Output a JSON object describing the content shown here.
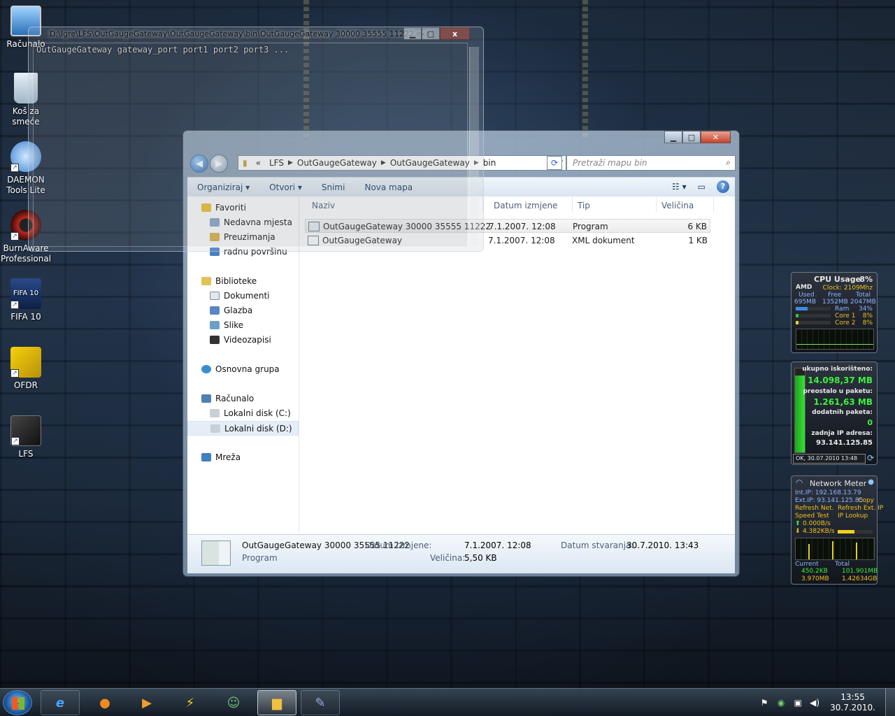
{
  "desktop": {
    "icons": [
      {
        "label": "Računalo",
        "icon": "computer-icon"
      },
      {
        "label": "Koš za smeće",
        "icon": "recycle-bin-icon"
      },
      {
        "label": "DAEMON Tools Lite",
        "icon": "daemon-tools-icon"
      },
      {
        "label": "BurnAware Professional",
        "icon": "burnaware-icon"
      },
      {
        "label": "FIFA 10",
        "icon": "fifa10-icon"
      },
      {
        "label": "OFDR",
        "icon": "ofdr-icon"
      },
      {
        "label": "LFS",
        "icon": "lfs-icon"
      }
    ],
    "icon_badge": "FIFA 10"
  },
  "console": {
    "title": "D:\\Igre\\LFS\\OutGaugeGateway\\OutGaugeGateway\\bin\\OutGaugeGateway 30000 35555 11222.exe",
    "output": "OutGaugeGateway gateway_port port1 port2 port3 ...",
    "close_label": "x"
  },
  "explorer": {
    "breadcrumb": [
      "LFS",
      "OutGaugeGateway",
      "OutGaugeGateway",
      "bin"
    ],
    "breadcrumb_prefix": "«",
    "search_placeholder": "Pretraži mapu bin",
    "toolbar": {
      "organize": "Organiziraj ▾",
      "open": "Otvori ▾",
      "burn": "Snimi",
      "new_folder": "Nova mapa",
      "help": "?"
    },
    "nav": {
      "favorites": "Favoriti",
      "recent": "Nedavna mjesta",
      "downloads": "Preuzimanja",
      "desktop": "radnu površinu",
      "libraries": "Biblioteke",
      "documents": "Dokumenti",
      "music": "Glazba",
      "pictures": "Slike",
      "videos": "Videozapisi",
      "homegroup": "Osnovna grupa",
      "computer": "Računalo",
      "disk_c": "Lokalni disk (C:)",
      "disk_d": "Lokalni disk (D:)",
      "network": "Mreža"
    },
    "columns": [
      "Naziv",
      "Datum izmjene",
      "Tip",
      "Veličina"
    ],
    "files": [
      {
        "name": "OutGaugeGateway 30000 35555 11222",
        "date": "7.1.2007. 12:08",
        "type": "Program",
        "size": "6 KB"
      },
      {
        "name": "OutGaugeGateway",
        "date": "7.1.2007. 12:08",
        "type": "XML dokument",
        "size": "1 KB"
      }
    ],
    "details": {
      "name": "OutGaugeGateway 30000 35555 11222",
      "kind": "Program",
      "modified_label": "Datum izmjene:",
      "modified": "7.1.2007. 12:08",
      "size_label": "Veličina:",
      "size": "5,50 KB",
      "created_label": "Datum stvaranja:",
      "created": "30.7.2010. 13:43"
    }
  },
  "gadget_cpu": {
    "title": "CPU Usage",
    "percent": "8%",
    "brand": "AMD",
    "clock": "Clock: 2109Mhz",
    "used_label": "Used",
    "free_label": "Free",
    "total_label": "Total",
    "used": "695MB",
    "free": "1352MB",
    "total": "2047MB",
    "ram_label": "Ram",
    "ram": "34%",
    "core1_label": "Core 1",
    "core1": "8%",
    "core2_label": "Core 2",
    "core2": "8%"
  },
  "gadget_traffic": {
    "used_label": "ukupno iskorišteno:",
    "used": "14.098,37 MB",
    "left_label": "preostalo u paketu:",
    "left": "1.261,63 MB",
    "extra_label": "dodatnih paketa:",
    "extra": "0",
    "ip_label": "zadnja IP adresa:",
    "ip": "93.141.125.85",
    "status": "OK, 30.07.2010 13:48",
    "fill_fraction": 0.92
  },
  "gadget_network": {
    "title": "Network Meter",
    "int_ip": "Int.IP: 192.168.13.79",
    "ext_ip": "Ext.IP: 93.141.125.85",
    "copy": "Copy",
    "refresh_net": "Refresh Net.",
    "refresh_ext": "Refresh Ext. IP",
    "speed_test": "Speed Test",
    "ip_lookup": "IP Lookup",
    "up_speed": "0.000B/s",
    "down_speed": "4.382KB/s",
    "current_label": "Current",
    "total_label": "Total",
    "cur_up": "450.2KB",
    "cur_down": "3.970MB",
    "tot_up": "101.901MB",
    "tot_down": "1.42634GB"
  },
  "taskbar": {
    "time": "13:55",
    "date": "30.7.2010.",
    "apps": [
      "internet-explorer-icon",
      "firefox-icon",
      "media-player-icon",
      "winamp-icon",
      "messenger-icon",
      "explorer-icon",
      "paint-icon"
    ]
  }
}
